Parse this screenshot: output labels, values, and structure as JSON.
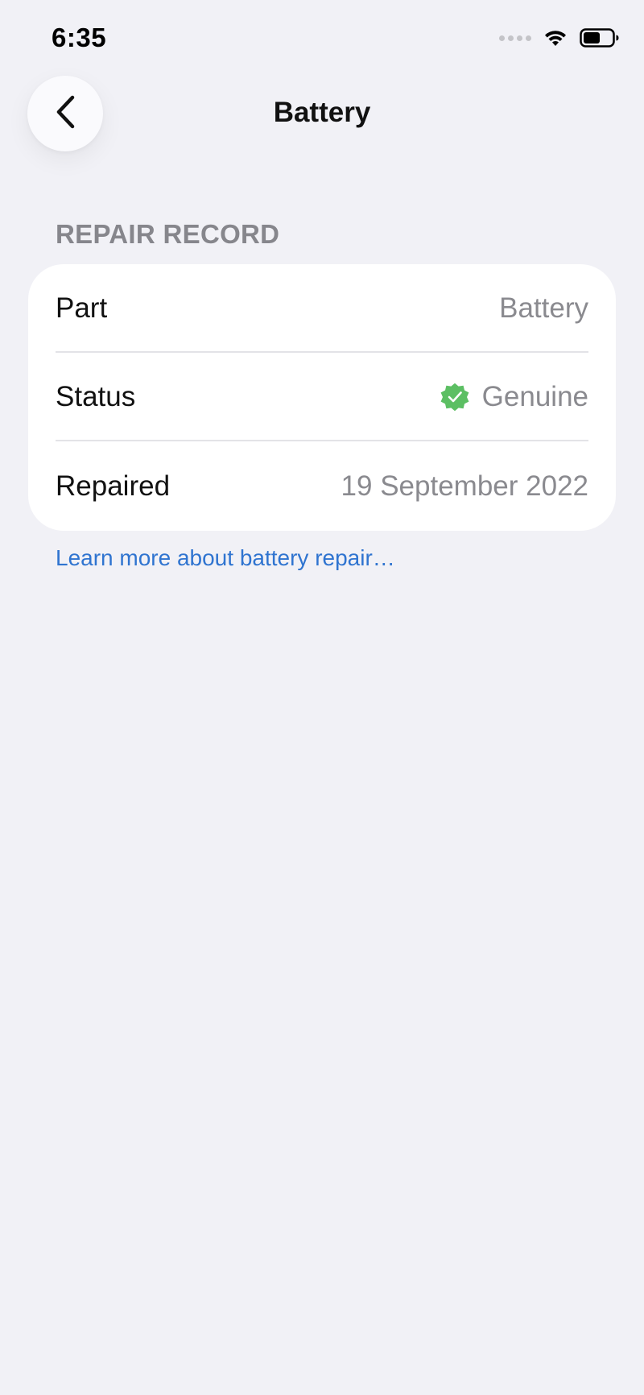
{
  "status_bar": {
    "time": "6:35",
    "icons": [
      "signal-dots-icon",
      "wifi-icon",
      "battery-icon"
    ]
  },
  "nav": {
    "back_icon": "chevron-left-icon",
    "title": "Battery"
  },
  "section": {
    "header": "REPAIR RECORD"
  },
  "repair_record": {
    "rows": [
      {
        "label": "Part",
        "value": "Battery"
      },
      {
        "label": "Status",
        "value": "Genuine",
        "icon": "verified-badge-icon"
      },
      {
        "label": "Repaired",
        "value": "19 September 2022"
      }
    ]
  },
  "link": {
    "text": "Learn more about battery repair…"
  },
  "colors": {
    "background": "#f1f1f6",
    "card": "#ffffff",
    "secondary_text": "#8a8a8f",
    "link": "#2f74d0",
    "verified_green": "#5cbf63"
  }
}
